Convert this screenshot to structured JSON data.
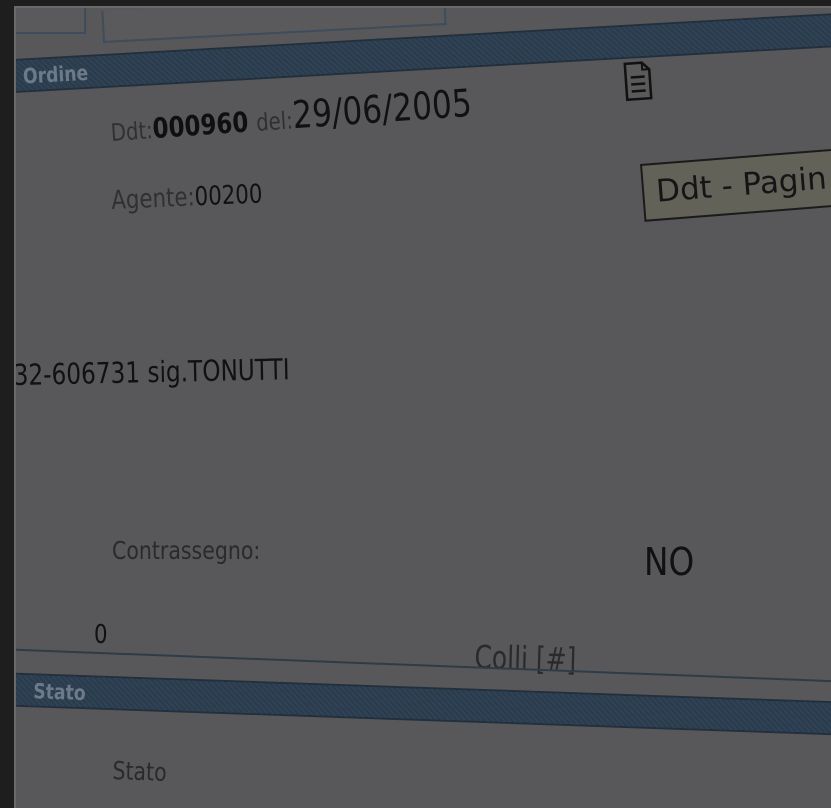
{
  "sections": {
    "ordine": {
      "title": "Ordine"
    },
    "stato": {
      "title": "Stato"
    }
  },
  "ddt": {
    "label": "Ddt:",
    "number": "000960",
    "del_label": "del:",
    "date": "29/06/2005"
  },
  "agente": {
    "label": "Agente:",
    "value": "00200"
  },
  "tooltip": {
    "text": "Ddt - Pagin"
  },
  "contact": {
    "text": "32-606731 sig.TONUTTI"
  },
  "contrassegno": {
    "label": "Contrassegno:",
    "value": "NO"
  },
  "colli": {
    "value": "0",
    "label": "Colli [#]"
  },
  "stato_field": {
    "label": "Stato"
  },
  "icons": {
    "document": "document-icon"
  },
  "colors": {
    "band": "#304356",
    "band_text": "#6c7a8a",
    "background": "#58585a",
    "tooltip_bg": "#626258"
  }
}
